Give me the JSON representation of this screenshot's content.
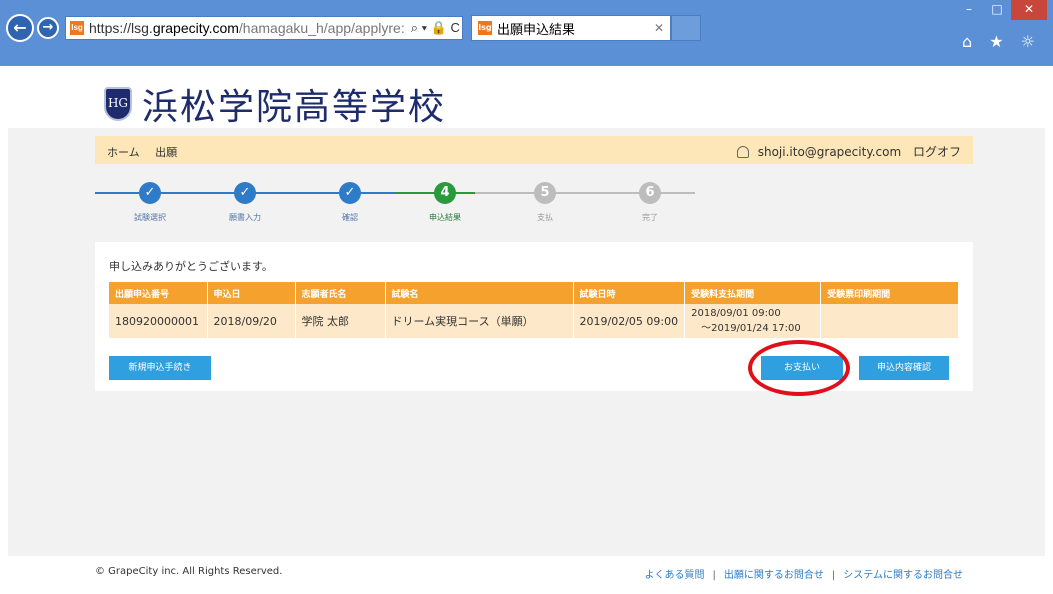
{
  "browser": {
    "url_host_prefix": "https://lsg.",
    "url_host": "grapecity.com",
    "url_path": "/hamagaku_h/app/applyre:",
    "url_icons": "⌕ ▾ 🔒 C",
    "tab_title": "出願申込結果",
    "favicon_text": "lsg",
    "tools": "⌂ ★ ☼"
  },
  "header": {
    "school_name": "浜松学院高等学校",
    "crest_letters": "HG"
  },
  "navbar": {
    "home": "ホーム",
    "apply": "出願",
    "user_email": "shoji.ito@grapecity.com",
    "logoff": "ログオフ"
  },
  "steps": [
    {
      "label": "試験選択",
      "mark": "✓",
      "state": "done"
    },
    {
      "label": "願書入力",
      "mark": "✓",
      "state": "done"
    },
    {
      "label": "確認",
      "mark": "✓",
      "state": "done"
    },
    {
      "label": "申込結果",
      "mark": "4",
      "state": "current"
    },
    {
      "label": "支払",
      "mark": "5",
      "state": "todo"
    },
    {
      "label": "完了",
      "mark": "6",
      "state": "todo"
    }
  ],
  "content": {
    "thanks": "申し込みありがとうございます。",
    "headers": [
      "出願申込番号",
      "申込日",
      "志願者氏名",
      "試験名",
      "試験日時",
      "受験料支払期間",
      "受験票印刷期間"
    ],
    "row": {
      "number": "180920000001",
      "date": "2018/09/20",
      "name": "学院 太郎",
      "exam": "ドリーム実現コース（単願）",
      "exam_datetime": "2019/02/05 09:00",
      "pay_from": "2018/09/01 09:00",
      "pay_to": "～2019/01/24 17:00",
      "print_period": ""
    },
    "buttons": {
      "new_apply": "新規申込手続き",
      "pay": "お支払い",
      "confirm": "申込内容確認"
    }
  },
  "footer": {
    "copyright": "© GrapeCity inc. All Rights Reserved.",
    "links": [
      "よくある質問",
      "出願に関するお問合せ",
      "システムに関するお問合せ"
    ],
    "separator": "|"
  },
  "colors": {
    "accent_orange": "#f5a12d",
    "button_blue": "#2f9fe0",
    "step_done": "#2e7cc7",
    "step_current": "#2a9a3e",
    "highlight_red": "#e0101a"
  }
}
